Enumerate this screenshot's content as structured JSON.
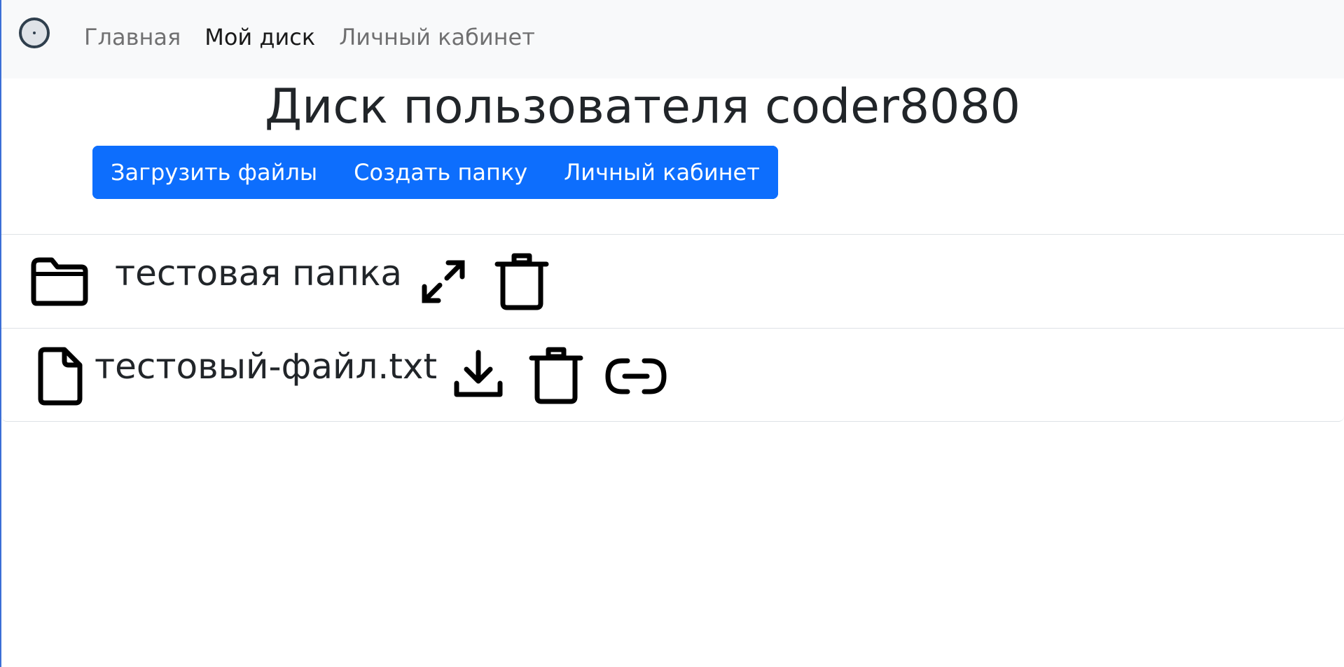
{
  "navbar": {
    "brand_icon": "disc-icon",
    "links": [
      {
        "label": "Главная",
        "active": false
      },
      {
        "label": "Мой диск",
        "active": true
      },
      {
        "label": "Личный кабинет",
        "active": false
      }
    ]
  },
  "page": {
    "title": "Диск пользователя coder8080"
  },
  "toolbar": {
    "upload_label": "Загрузить файлы",
    "create_folder_label": "Создать папку",
    "profile_label": "Личный кабинет"
  },
  "items": [
    {
      "type": "folder",
      "icon": "folder-icon",
      "name": "тестовая папка",
      "actions": [
        "expand-icon",
        "trash-icon"
      ]
    },
    {
      "type": "file",
      "icon": "file-icon",
      "name": "тестовый-файл.txt",
      "actions": [
        "download-icon",
        "trash-icon",
        "link-icon"
      ]
    }
  ],
  "colors": {
    "primary": "#0d6efd",
    "navbar_bg": "#f8f9fa",
    "text": "#212529"
  }
}
